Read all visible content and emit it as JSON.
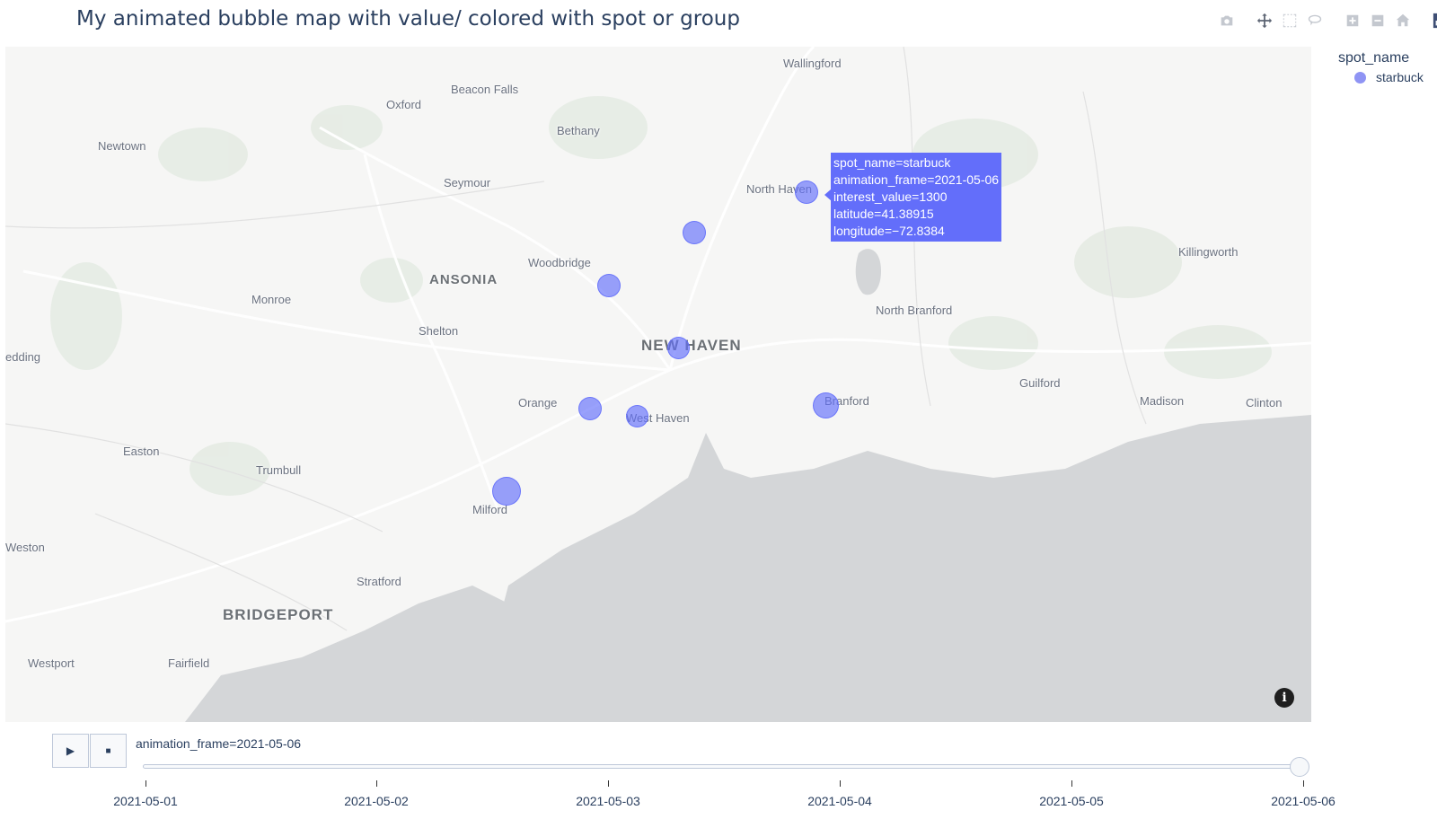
{
  "title": "My animated bubble map with value/ colored with spot or group",
  "modebar": {
    "buttons": [
      "camera-icon",
      "pan-icon",
      "box-select-icon",
      "lasso-icon",
      "zoom-in-icon",
      "zoom-out-icon",
      "reset-home-icon",
      "plotly-logo-icon"
    ]
  },
  "legend": {
    "title": "spot_name",
    "items": [
      {
        "label": "starbuck",
        "color": "#636efa"
      }
    ]
  },
  "map": {
    "places": [
      "Wallingford",
      "Beacon Falls",
      "Oxford",
      "Bethany",
      "Newtown",
      "Seymour",
      "North Haven",
      "Killingworth",
      "Woodbridge",
      "ANSONIA",
      "Monroe",
      "Shelton",
      "North Branford",
      "NEW HAVEN",
      "edding",
      "Guilford",
      "Orange",
      "West Haven",
      "Branford",
      "Madison",
      "Clinton",
      "Easton",
      "Trumbull",
      "Milford",
      "Weston",
      "Stratford",
      "BRIDGEPORT",
      "Westport",
      "Fairfield"
    ],
    "info_label": "i"
  },
  "hover": {
    "lines": [
      "spot_name=starbuck",
      "animation_frame=2021-05-06",
      "interest_value=1300",
      "latitude=41.38915",
      "longitude=−72.8384"
    ]
  },
  "animation": {
    "play_icon": "▶",
    "stop_icon": "■",
    "current_label": "animation_frame=2021-05-06",
    "frames": [
      "2021-05-01",
      "2021-05-02",
      "2021-05-03",
      "2021-05-04",
      "2021-05-05",
      "2021-05-06"
    ],
    "current_index": 5
  },
  "chart_data": {
    "type": "scatter",
    "subtype": "scatter_mapbox bubble",
    "title": "My animated bubble map with value/ colored with spot or group",
    "color_legend_title": "spot_name",
    "series": [
      {
        "name": "starbuck",
        "color": "#636efa",
        "frame": "2021-05-06",
        "points": [
          {
            "latitude": 41.38915,
            "longitude": -72.8384,
            "interest_value": 1300
          },
          {
            "latitude": 41.36,
            "longitude": -72.92,
            "interest_value": null
          },
          {
            "latitude": 41.33,
            "longitude": -72.99,
            "interest_value": null
          },
          {
            "latitude": 41.31,
            "longitude": -72.93,
            "interest_value": null
          },
          {
            "latitude": 41.28,
            "longitude": -73.01,
            "interest_value": null
          },
          {
            "latitude": 41.275,
            "longitude": -72.965,
            "interest_value": null
          },
          {
            "latitude": 41.28,
            "longitude": -72.82,
            "interest_value": null
          },
          {
            "latitude": 41.23,
            "longitude": -73.06,
            "interest_value": null
          }
        ]
      }
    ]
  }
}
